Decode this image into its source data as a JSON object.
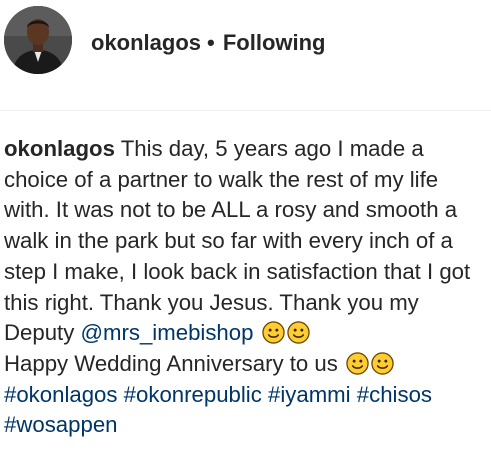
{
  "header": {
    "username": "okonlagos",
    "separator": "•",
    "follow_status": "Following"
  },
  "caption": {
    "username": "okonlagos",
    "text_part1": "This day, 5 years ago I made a choice of a partner to walk the rest of my life with. It was not to be ALL a rosy and smooth a walk in the park but so far with every inch of a step I make, I look back in satisfaction that I got this right. Thank you Jesus. Thank you my Deputy",
    "mention": "@mrs_imebishop",
    "text_part2": "Happy Wedding Anniversary to us",
    "emoji_name": "slightly-smiling-face",
    "hashtags": [
      "#okonlagos",
      "#okonrepublic",
      "#iyammi",
      "#chisos",
      "#wosappen"
    ]
  },
  "colors": {
    "text": "#262626",
    "link": "#003569",
    "divider": "#efefef",
    "emoji_face": "#FFCC33",
    "emoji_outline": "#6b4a00"
  }
}
